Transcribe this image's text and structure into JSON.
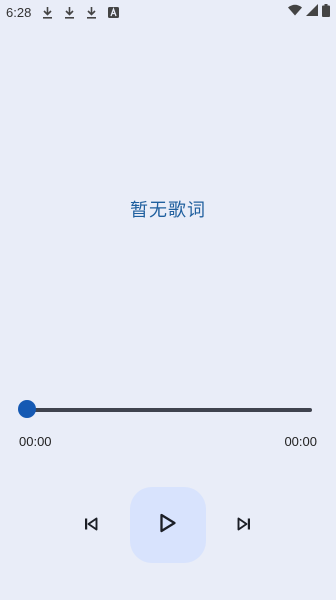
{
  "status_bar": {
    "time": "6:28",
    "icons": [
      "download-icon",
      "download-icon",
      "download-icon",
      "font-a-icon"
    ],
    "right_icons": [
      "wifi-icon",
      "cellular-icon",
      "battery-icon"
    ]
  },
  "lyrics": {
    "text": "暂无歌词"
  },
  "player": {
    "elapsed": "00:00",
    "duration": "00:00",
    "progress": 0,
    "accent_color": "#1559b3",
    "play_button_bg": "#d8e3fd"
  },
  "controls": {
    "previous_icon": "skip-previous-icon",
    "play_icon": "play-icon",
    "next_icon": "skip-next-icon"
  }
}
